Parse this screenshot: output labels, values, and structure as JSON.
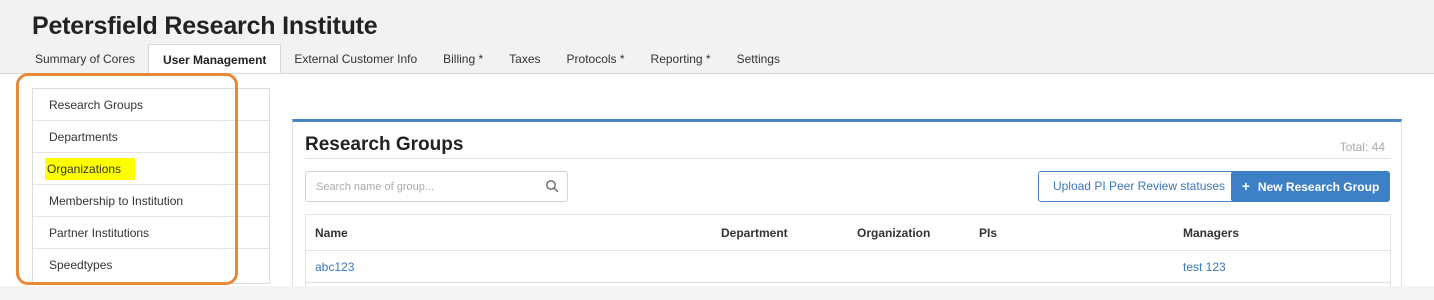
{
  "app": {
    "title": "Petersfield Research Institute"
  },
  "tabs": [
    {
      "label": "Summary of Cores"
    },
    {
      "label": "User Management"
    },
    {
      "label": "External Customer Info"
    },
    {
      "label": "Billing *"
    },
    {
      "label": "Taxes"
    },
    {
      "label": "Protocols *"
    },
    {
      "label": "Reporting *"
    },
    {
      "label": "Settings"
    }
  ],
  "sidebar": {
    "items": [
      {
        "label": "Research Groups"
      },
      {
        "label": "Departments"
      },
      {
        "label": "Organizations"
      },
      {
        "label": "Membership to Institution"
      },
      {
        "label": "Partner Institutions"
      },
      {
        "label": "Speedtypes"
      }
    ]
  },
  "panel": {
    "title": "Research Groups",
    "total": "Total: 44",
    "search_placeholder": "Search name of group...",
    "upload_button": "Upload PI Peer Review statuses",
    "new_button": "New Research Group"
  },
  "table": {
    "columns": [
      "Name",
      "Department",
      "Organization",
      "PIs",
      "Managers"
    ],
    "rows": [
      {
        "name": "abc123",
        "department": "",
        "organization": "",
        "pis": "",
        "managers": "test 123"
      }
    ]
  },
  "colors": {
    "accent": "#3e80c6",
    "highlight": "#ffff00",
    "annotation": "#e8893a"
  },
  "icons": {
    "search": "search-icon",
    "plus": "plus-icon"
  }
}
